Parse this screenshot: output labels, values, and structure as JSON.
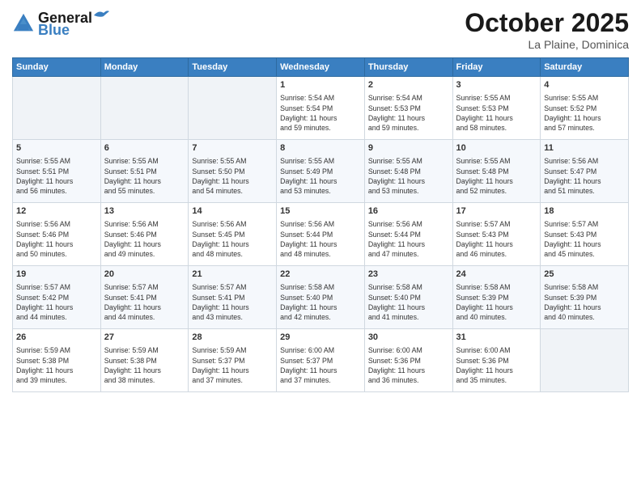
{
  "header": {
    "logo_line1": "General",
    "logo_line2": "Blue",
    "title": "October 2025",
    "subtitle": "La Plaine, Dominica"
  },
  "days_of_week": [
    "Sunday",
    "Monday",
    "Tuesday",
    "Wednesday",
    "Thursday",
    "Friday",
    "Saturday"
  ],
  "weeks": [
    [
      {
        "day": "",
        "lines": []
      },
      {
        "day": "",
        "lines": []
      },
      {
        "day": "",
        "lines": []
      },
      {
        "day": "1",
        "lines": [
          "Sunrise: 5:54 AM",
          "Sunset: 5:54 PM",
          "Daylight: 11 hours",
          "and 59 minutes."
        ]
      },
      {
        "day": "2",
        "lines": [
          "Sunrise: 5:54 AM",
          "Sunset: 5:53 PM",
          "Daylight: 11 hours",
          "and 59 minutes."
        ]
      },
      {
        "day": "3",
        "lines": [
          "Sunrise: 5:55 AM",
          "Sunset: 5:53 PM",
          "Daylight: 11 hours",
          "and 58 minutes."
        ]
      },
      {
        "day": "4",
        "lines": [
          "Sunrise: 5:55 AM",
          "Sunset: 5:52 PM",
          "Daylight: 11 hours",
          "and 57 minutes."
        ]
      }
    ],
    [
      {
        "day": "5",
        "lines": [
          "Sunrise: 5:55 AM",
          "Sunset: 5:51 PM",
          "Daylight: 11 hours",
          "and 56 minutes."
        ]
      },
      {
        "day": "6",
        "lines": [
          "Sunrise: 5:55 AM",
          "Sunset: 5:51 PM",
          "Daylight: 11 hours",
          "and 55 minutes."
        ]
      },
      {
        "day": "7",
        "lines": [
          "Sunrise: 5:55 AM",
          "Sunset: 5:50 PM",
          "Daylight: 11 hours",
          "and 54 minutes."
        ]
      },
      {
        "day": "8",
        "lines": [
          "Sunrise: 5:55 AM",
          "Sunset: 5:49 PM",
          "Daylight: 11 hours",
          "and 53 minutes."
        ]
      },
      {
        "day": "9",
        "lines": [
          "Sunrise: 5:55 AM",
          "Sunset: 5:48 PM",
          "Daylight: 11 hours",
          "and 53 minutes."
        ]
      },
      {
        "day": "10",
        "lines": [
          "Sunrise: 5:55 AM",
          "Sunset: 5:48 PM",
          "Daylight: 11 hours",
          "and 52 minutes."
        ]
      },
      {
        "day": "11",
        "lines": [
          "Sunrise: 5:56 AM",
          "Sunset: 5:47 PM",
          "Daylight: 11 hours",
          "and 51 minutes."
        ]
      }
    ],
    [
      {
        "day": "12",
        "lines": [
          "Sunrise: 5:56 AM",
          "Sunset: 5:46 PM",
          "Daylight: 11 hours",
          "and 50 minutes."
        ]
      },
      {
        "day": "13",
        "lines": [
          "Sunrise: 5:56 AM",
          "Sunset: 5:46 PM",
          "Daylight: 11 hours",
          "and 49 minutes."
        ]
      },
      {
        "day": "14",
        "lines": [
          "Sunrise: 5:56 AM",
          "Sunset: 5:45 PM",
          "Daylight: 11 hours",
          "and 48 minutes."
        ]
      },
      {
        "day": "15",
        "lines": [
          "Sunrise: 5:56 AM",
          "Sunset: 5:44 PM",
          "Daylight: 11 hours",
          "and 48 minutes."
        ]
      },
      {
        "day": "16",
        "lines": [
          "Sunrise: 5:56 AM",
          "Sunset: 5:44 PM",
          "Daylight: 11 hours",
          "and 47 minutes."
        ]
      },
      {
        "day": "17",
        "lines": [
          "Sunrise: 5:57 AM",
          "Sunset: 5:43 PM",
          "Daylight: 11 hours",
          "and 46 minutes."
        ]
      },
      {
        "day": "18",
        "lines": [
          "Sunrise: 5:57 AM",
          "Sunset: 5:43 PM",
          "Daylight: 11 hours",
          "and 45 minutes."
        ]
      }
    ],
    [
      {
        "day": "19",
        "lines": [
          "Sunrise: 5:57 AM",
          "Sunset: 5:42 PM",
          "Daylight: 11 hours",
          "and 44 minutes."
        ]
      },
      {
        "day": "20",
        "lines": [
          "Sunrise: 5:57 AM",
          "Sunset: 5:41 PM",
          "Daylight: 11 hours",
          "and 44 minutes."
        ]
      },
      {
        "day": "21",
        "lines": [
          "Sunrise: 5:57 AM",
          "Sunset: 5:41 PM",
          "Daylight: 11 hours",
          "and 43 minutes."
        ]
      },
      {
        "day": "22",
        "lines": [
          "Sunrise: 5:58 AM",
          "Sunset: 5:40 PM",
          "Daylight: 11 hours",
          "and 42 minutes."
        ]
      },
      {
        "day": "23",
        "lines": [
          "Sunrise: 5:58 AM",
          "Sunset: 5:40 PM",
          "Daylight: 11 hours",
          "and 41 minutes."
        ]
      },
      {
        "day": "24",
        "lines": [
          "Sunrise: 5:58 AM",
          "Sunset: 5:39 PM",
          "Daylight: 11 hours",
          "and 40 minutes."
        ]
      },
      {
        "day": "25",
        "lines": [
          "Sunrise: 5:58 AM",
          "Sunset: 5:39 PM",
          "Daylight: 11 hours",
          "and 40 minutes."
        ]
      }
    ],
    [
      {
        "day": "26",
        "lines": [
          "Sunrise: 5:59 AM",
          "Sunset: 5:38 PM",
          "Daylight: 11 hours",
          "and 39 minutes."
        ]
      },
      {
        "day": "27",
        "lines": [
          "Sunrise: 5:59 AM",
          "Sunset: 5:38 PM",
          "Daylight: 11 hours",
          "and 38 minutes."
        ]
      },
      {
        "day": "28",
        "lines": [
          "Sunrise: 5:59 AM",
          "Sunset: 5:37 PM",
          "Daylight: 11 hours",
          "and 37 minutes."
        ]
      },
      {
        "day": "29",
        "lines": [
          "Sunrise: 6:00 AM",
          "Sunset: 5:37 PM",
          "Daylight: 11 hours",
          "and 37 minutes."
        ]
      },
      {
        "day": "30",
        "lines": [
          "Sunrise: 6:00 AM",
          "Sunset: 5:36 PM",
          "Daylight: 11 hours",
          "and 36 minutes."
        ]
      },
      {
        "day": "31",
        "lines": [
          "Sunrise: 6:00 AM",
          "Sunset: 5:36 PM",
          "Daylight: 11 hours",
          "and 35 minutes."
        ]
      },
      {
        "day": "",
        "lines": []
      }
    ]
  ]
}
